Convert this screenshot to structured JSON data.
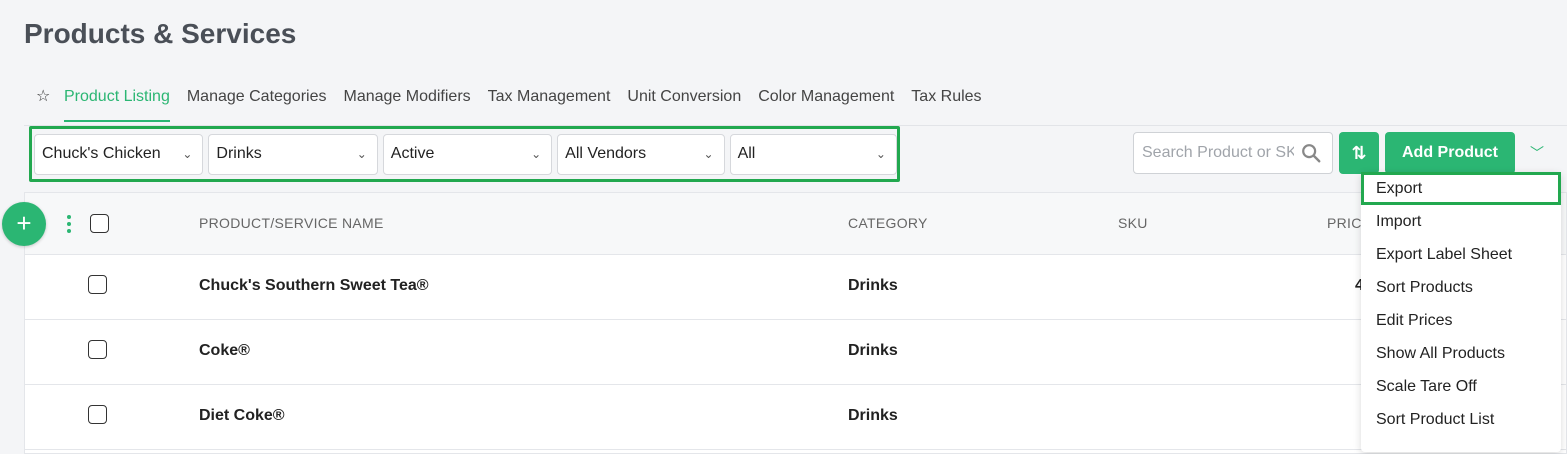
{
  "page": {
    "title": "Products & Services"
  },
  "tabs": [
    {
      "label": "Product Listing",
      "active": true
    },
    {
      "label": "Manage Categories"
    },
    {
      "label": "Manage Modifiers"
    },
    {
      "label": "Tax Management"
    },
    {
      "label": "Unit Conversion"
    },
    {
      "label": "Color Management"
    },
    {
      "label": "Tax Rules"
    }
  ],
  "filters": {
    "location": "Chuck's Chicken",
    "category": "Drinks",
    "status": "Active",
    "vendor": "All Vendors",
    "type": "All"
  },
  "search": {
    "placeholder": "Search Product or SKU"
  },
  "actions": {
    "add_label": "Add Product"
  },
  "table": {
    "headers": {
      "name": "PRODUCT/SERVICE NAME",
      "category": "CATEGORY",
      "sku": "SKU",
      "price": "PRIC"
    },
    "rows": [
      {
        "name": "Chuck's Southern Sweet Tea®",
        "category": "Drinks",
        "price": "4"
      },
      {
        "name": "Coke®",
        "category": "Drinks"
      },
      {
        "name": "Diet Coke®",
        "category": "Drinks"
      }
    ]
  },
  "menu": {
    "items": [
      "Export",
      "Import",
      "Export Label Sheet",
      "Sort Products",
      "Edit Prices",
      "Show All Products",
      "Scale Tare Off",
      "Sort Product List"
    ]
  },
  "colors": {
    "accent": "#2bb673",
    "highlight": "#22a84f"
  }
}
